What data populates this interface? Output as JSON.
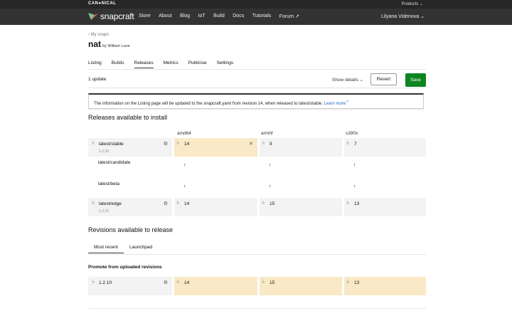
{
  "topbar": {
    "brand": "CAN●NICAL",
    "products": "Products ⌄"
  },
  "nav": {
    "logo_text": "snapcraft",
    "items": [
      "Store",
      "About",
      "Blog",
      "IoT",
      "Build",
      "Docs",
      "Tutorials",
      "Forum ↗"
    ],
    "user": "Lilyana Videnova ⌄"
  },
  "breadcrumb": "‹ My snaps",
  "snap": {
    "name": "nat",
    "by": "by William Lane"
  },
  "tabs": [
    "Listing",
    "Builds",
    "Releases",
    "Metrics",
    "Publicise",
    "Settings"
  ],
  "active_tab": "Releases",
  "toolbar": {
    "update_count": "1 update",
    "show_details": "Show details ⌄",
    "revert": "Revert",
    "save": "Save"
  },
  "notice": {
    "text": "The information on the Listing page will be updated to the snapcraft.yaml from revision 14, when released to latest/stable.",
    "link": "Learn more"
  },
  "releases": {
    "heading": "Releases available to install",
    "architectures": [
      "amd64",
      "armhf",
      "s390x"
    ],
    "channels": [
      {
        "name": "latest/stable",
        "version": "1.2.10",
        "revisions": [
          "14",
          "9",
          "7"
        ]
      },
      {
        "name": "latest/candidate",
        "version": "",
        "revisions": [
          "↑",
          "↑",
          "↑"
        ]
      },
      {
        "name": "latest/beta",
        "version": "",
        "revisions": [
          "↑",
          "↑",
          "↑"
        ]
      },
      {
        "name": "latest/edge",
        "version": "1.2.10",
        "revisions": [
          "14",
          "15",
          "13"
        ]
      }
    ]
  },
  "revisions": {
    "heading": "Revisions available to release",
    "tabs": [
      "Most recent",
      "Launchpad"
    ],
    "promote_heading": "Promote from uploaded revisions",
    "row": {
      "version": "1.2.10",
      "revisions": [
        "14",
        "15",
        "13"
      ]
    }
  },
  "colors": {
    "accent_green": "#0e8420",
    "highlight": "#f9e9c6",
    "nav_bg": "#333333",
    "link": "#2a68c8"
  }
}
